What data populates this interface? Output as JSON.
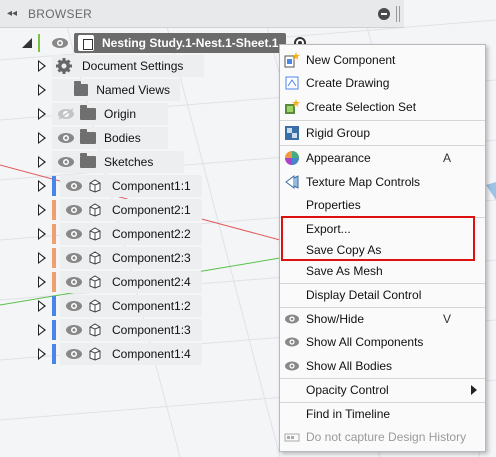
{
  "browser": {
    "title": "BROWSER",
    "root": "Nesting Study.1-Nest.1-Sheet.1"
  },
  "tree": {
    "items": [
      {
        "label": "Document Settings"
      },
      {
        "label": "Named Views"
      },
      {
        "label": "Origin"
      },
      {
        "label": "Bodies"
      },
      {
        "label": "Sketches"
      }
    ],
    "components": [
      {
        "label": "Component1:1",
        "color": "#4a86e8"
      },
      {
        "label": "Component2:1",
        "color": "#f0a070"
      },
      {
        "label": "Component2:2",
        "color": "#f0a070"
      },
      {
        "label": "Component2:3",
        "color": "#f0a070"
      },
      {
        "label": "Component2:4",
        "color": "#f0a070"
      },
      {
        "label": "Component1:2",
        "color": "#4a86e8"
      },
      {
        "label": "Component1:3",
        "color": "#4a86e8"
      },
      {
        "label": "Component1:4",
        "color": "#4a86e8"
      }
    ]
  },
  "menu": {
    "new_component": "New Component",
    "create_drawing": "Create Drawing",
    "create_selection_set": "Create Selection Set",
    "rigid_group": "Rigid Group",
    "appearance": "Appearance",
    "appearance_shortcut": "A",
    "texture_map_controls": "Texture Map Controls",
    "properties": "Properties",
    "export": "Export...",
    "save_copy_as": "Save Copy As",
    "save_as_mesh": "Save As Mesh",
    "display_detail_control": "Display Detail Control",
    "show_hide": "Show/Hide",
    "show_hide_shortcut": "V",
    "show_all_components": "Show All Components",
    "show_all_bodies": "Show All Bodies",
    "opacity_control": "Opacity Control",
    "find_in_timeline": "Find in Timeline",
    "do_not_capture": "Do not capture Design History"
  },
  "colors": {
    "highlight": "#dd1111",
    "component_blue": "#4a86e8",
    "component_orange": "#f0a070"
  }
}
